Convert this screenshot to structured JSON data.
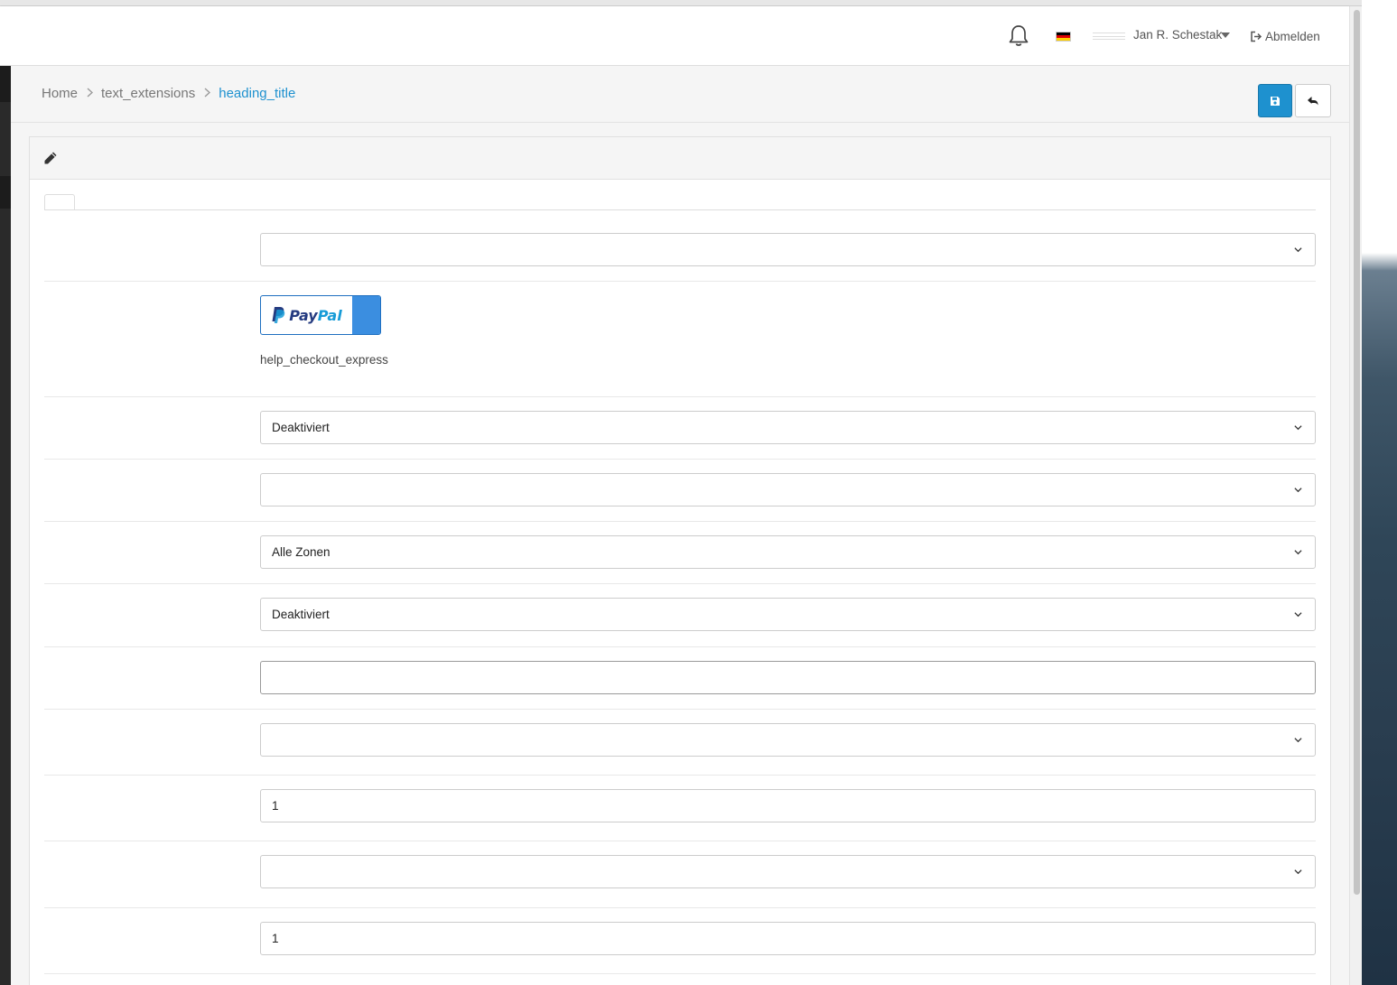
{
  "header": {
    "user_name": "Jan R. Schestak",
    "logout_label": "Abmelden",
    "language_flag": "de-flag-icon",
    "notification_icon": "bell-icon"
  },
  "breadcrumb": {
    "items": [
      "Home",
      "text_extensions",
      "heading_title"
    ]
  },
  "actions": {
    "save_icon": "floppy-disk-icon",
    "back_icon": "reply-arrow-icon"
  },
  "form": {
    "rows": [
      {
        "type": "select",
        "value": ""
      },
      {
        "type": "paypal",
        "button_text": "PayPal",
        "help": "help_checkout_express"
      },
      {
        "type": "select",
        "value": "Deaktiviert"
      },
      {
        "type": "select",
        "value": ""
      },
      {
        "type": "select",
        "value": "Alle Zonen"
      },
      {
        "type": "select",
        "value": "Deaktiviert"
      },
      {
        "type": "text",
        "value": ""
      },
      {
        "type": "select",
        "value": ""
      },
      {
        "type": "text",
        "value": "1"
      },
      {
        "type": "select",
        "value": ""
      },
      {
        "type": "text",
        "value": "1"
      }
    ]
  },
  "colors": {
    "primary": "#1e91cf",
    "paypal_blue": "#3b8ee0",
    "paypal_dark": "#253b80",
    "paypal_light": "#179bd7"
  }
}
